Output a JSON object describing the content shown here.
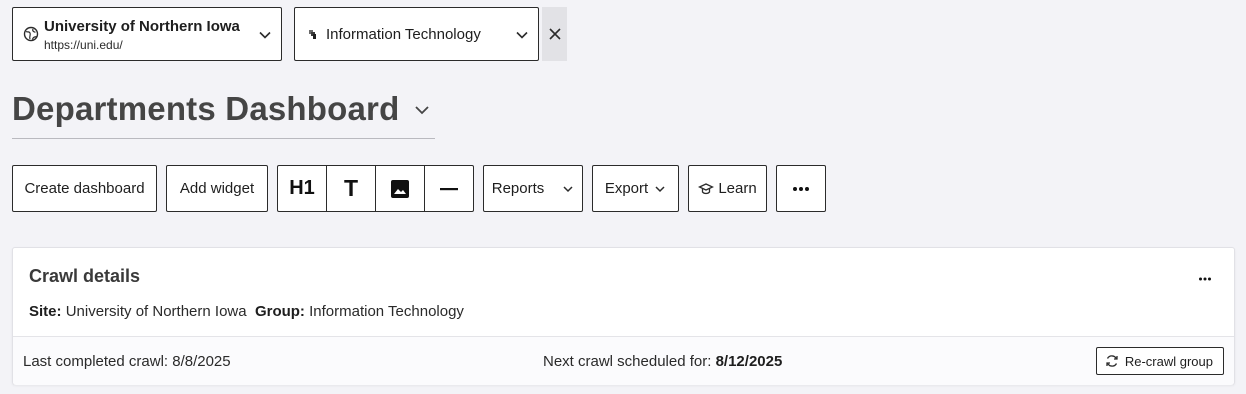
{
  "site_selector": {
    "name": "University of Northern Iowa",
    "url": "https://uni.edu/",
    "icon": "globe-icon"
  },
  "group_selector": {
    "name": "Information Technology",
    "icon": "group-icon"
  },
  "clear_button": {
    "icon": "close-icon"
  },
  "dashboard": {
    "title": "Departments Dashboard",
    "menu_icon": "chevron-down-icon"
  },
  "toolbar": {
    "create_dashboard": "Create dashboard",
    "add_widget": "Add widget",
    "heading_label": "H1",
    "text_label": "T",
    "image_icon": "image-icon",
    "divider_icon": "horizontal-rule-icon",
    "reports": "Reports",
    "export": "Export",
    "learn": "Learn",
    "more_icon": "ellipsis-icon"
  },
  "crawl_card": {
    "title": "Crawl details",
    "site_label": "Site:",
    "site_value": "University of Northern Iowa",
    "group_label": "Group:",
    "group_value": "Information Technology",
    "last_crawl_text": "Last completed crawl: 8/8/2025",
    "next_crawl_label": "Next crawl scheduled for:",
    "next_crawl_date": "8/12/2025",
    "recrawl_button": "Re-crawl group",
    "more_icon": "ellipsis-icon"
  },
  "colors": {
    "page_background": "#f3f3f7",
    "border": "#2b2b2b",
    "title_text": "#454545"
  }
}
